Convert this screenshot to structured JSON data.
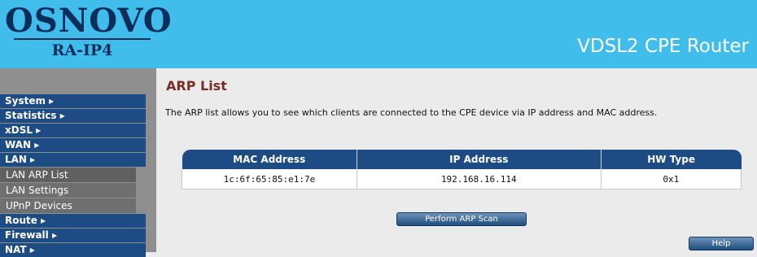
{
  "header": {
    "brand": "OSNOVO",
    "model": "RA-IP4",
    "product_title": "VDSL2 CPE Router"
  },
  "sidebar": {
    "items": [
      {
        "label": "System ▸"
      },
      {
        "label": "Statistics ▸"
      },
      {
        "label": "xDSL ▸"
      },
      {
        "label": "WAN ▸"
      },
      {
        "label": "LAN ▸"
      }
    ],
    "lan_sub": [
      {
        "label": "LAN ARP List"
      },
      {
        "label": "LAN Settings"
      },
      {
        "label": "UPnP Devices"
      }
    ],
    "items_after": [
      {
        "label": "Route ▸"
      },
      {
        "label": "Firewall ▸"
      },
      {
        "label": "NAT ▸"
      }
    ]
  },
  "main": {
    "title": "ARP List",
    "description": "The ARP list allows you to see which clients are connected to the CPE device via IP address and MAC address.",
    "table": {
      "headers": [
        "MAC Address",
        "IP Address",
        "HW Type"
      ],
      "rows": [
        [
          "1c:6f:65:85:e1:7e",
          "192.168.16.114",
          "0x1"
        ]
      ]
    },
    "scan_button": "Perform ARP Scan",
    "help_button": "Help"
  }
}
